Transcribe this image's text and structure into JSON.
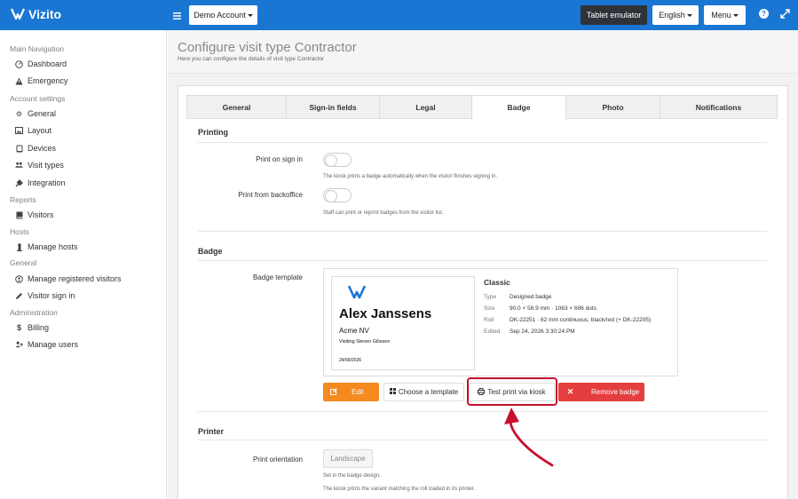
{
  "app": {
    "name": "Vizito"
  },
  "topbar": {
    "account": "Demo Account",
    "tablet_emulator": "Tablet emulator",
    "language": "English",
    "menu": "Menu"
  },
  "sidebar": {
    "sections": [
      {
        "title": "Main Navigation",
        "items": [
          {
            "label": "Dashboard",
            "icon": "gauge-icon"
          },
          {
            "label": "Emergency",
            "icon": "warning-icon"
          }
        ]
      },
      {
        "title": "Account settings",
        "items": [
          {
            "label": "General",
            "icon": "gear-icon"
          },
          {
            "label": "Layout",
            "icon": "image-icon"
          },
          {
            "label": "Devices",
            "icon": "tablet-icon"
          },
          {
            "label": "Visit types",
            "icon": "users-icon"
          },
          {
            "label": "Integration",
            "icon": "plug-icon"
          }
        ]
      },
      {
        "title": "Reports",
        "items": [
          {
            "label": "Visitors",
            "icon": "book-icon"
          }
        ]
      },
      {
        "title": "Hosts",
        "items": [
          {
            "label": "Manage hosts",
            "icon": "person-icon"
          }
        ]
      },
      {
        "title": "General",
        "items": [
          {
            "label": "Manage registered visitors",
            "icon": "id-icon"
          },
          {
            "label": "Visitor sign in",
            "icon": "pencil-icon"
          }
        ]
      },
      {
        "title": "Administration",
        "items": [
          {
            "label": "Billing",
            "icon": "dollar-icon"
          },
          {
            "label": "Manage users",
            "icon": "user-plus-icon"
          }
        ]
      }
    ]
  },
  "page": {
    "title": "Configure visit type Contractor",
    "subtitle": "Here you can configure the details of visit type Contractor"
  },
  "tabs": [
    "General",
    "Sign-in fields",
    "Legal",
    "Badge",
    "Photo",
    "Notifications"
  ],
  "active_tab": "Badge",
  "printing": {
    "title": "Printing",
    "print_on_sign_in": "Print on sign in",
    "print_on_sign_in_help": "The kiosk prints a badge automatically when the visitor finishes signing in.",
    "print_from_backoffice": "Print from backoffice",
    "print_from_backoffice_help": "Staff can print or reprint badges from the visitor list."
  },
  "badge": {
    "title": "Badge",
    "template_label": "Badge template",
    "preview": {
      "name": "Alex Janssens",
      "company": "Acme NV",
      "visiting": "Visiting Steven Gilissen",
      "date": "24/09/2026"
    },
    "info_title": "Classic",
    "info": [
      {
        "key": "Type",
        "value": "Designed badge"
      },
      {
        "key": "Size",
        "value": "90.0 × 58.9 mm · 1063 × 696 dots"
      },
      {
        "key": "Roll",
        "value": "DK-22251 · 62 mm continuous, black/red (+ DK-22205)"
      },
      {
        "key": "Edited",
        "value": "Sep 24, 2026 3:30:24 PM"
      }
    ],
    "buttons": {
      "edit": "Edit",
      "choose": "Choose a template",
      "test": "Test print via kiosk",
      "remove": "Remove badge"
    }
  },
  "printer": {
    "title": "Printer",
    "orientation_label": "Print orientation",
    "orientation_value": "Landscape",
    "help1": "Set in the badge design.",
    "help2": "The kiosk prints the variant matching the roll loaded in its printer."
  },
  "colors": {
    "brand": "#1976d2",
    "edit": "#f58a1f",
    "remove": "#e53e3e",
    "annotation": "#c8102e"
  }
}
